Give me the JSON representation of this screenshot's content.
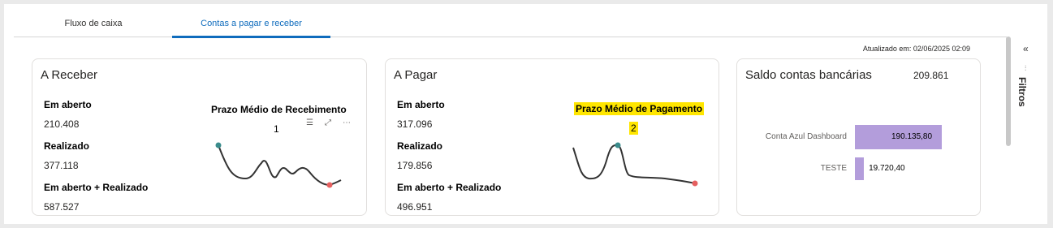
{
  "tabs": [
    "Fluxo de caixa",
    "Contas a pagar e receber"
  ],
  "updated": "Atualizado em: 02/06/2025 02:09",
  "receber": {
    "title": "A Receber",
    "rows": [
      {
        "label": "Em aberto",
        "value": "210.408"
      },
      {
        "label": "Realizado",
        "value": "377.118"
      },
      {
        "label": "Em aberto + Realizado",
        "value": "587.527"
      }
    ],
    "chart_title": "Prazo Médio de Recebimento",
    "chart_value": "1"
  },
  "pagar": {
    "title": "A Pagar",
    "rows": [
      {
        "label": "Em aberto",
        "value": "317.096"
      },
      {
        "label": "Realizado",
        "value": "179.856"
      },
      {
        "label": "Em aberto + Realizado",
        "value": "496.951"
      }
    ],
    "chart_title": "Prazo Médio de Pagamento",
    "chart_value": "2"
  },
  "saldo": {
    "title": "Saldo contas bancárias",
    "total": "209.861"
  },
  "filters_label": "Filtros",
  "chart_data": {
    "type": "bar",
    "categories": [
      "Conta Azul Dashboard",
      "TESTE"
    ],
    "values": [
      190135.8,
      19720.4
    ],
    "labels": [
      "190.135,80",
      "19.720,40"
    ],
    "orientation": "horizontal",
    "color": "#b39ddb"
  }
}
